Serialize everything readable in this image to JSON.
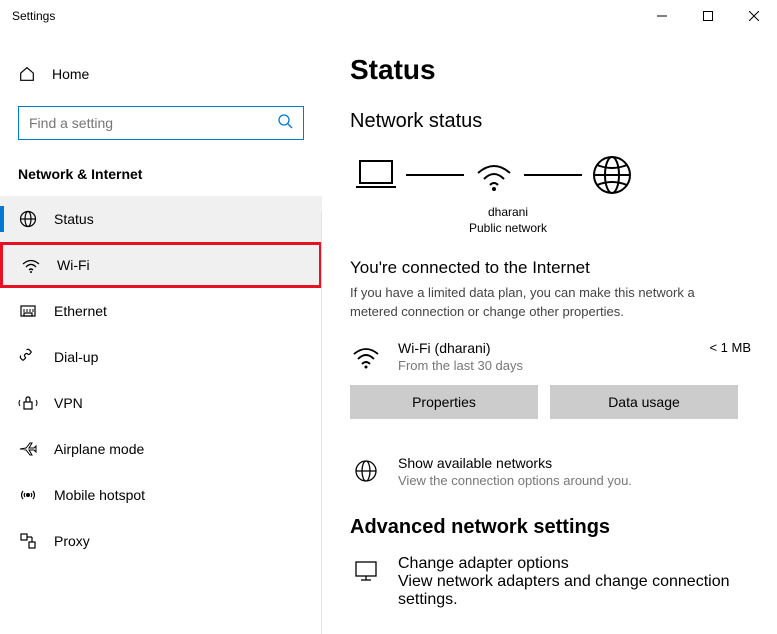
{
  "window": {
    "title": "Settings"
  },
  "sidebar": {
    "home": "Home",
    "search_placeholder": "Find a setting",
    "section": "Network & Internet",
    "items": [
      {
        "label": "Status"
      },
      {
        "label": "Wi-Fi"
      },
      {
        "label": "Ethernet"
      },
      {
        "label": "Dial-up"
      },
      {
        "label": "VPN"
      },
      {
        "label": "Airplane mode"
      },
      {
        "label": "Mobile hotspot"
      },
      {
        "label": "Proxy"
      }
    ]
  },
  "main": {
    "title": "Status",
    "network_status_heading": "Network status",
    "diagram": {
      "ssid": "dharani",
      "network_type": "Public network"
    },
    "connected_title": "You're connected to the Internet",
    "connected_desc": "If you have a limited data plan, you can make this network a metered connection or change other properties.",
    "connection": {
      "name": "Wi-Fi (dharani)",
      "period": "From the last 30 days",
      "usage": "< 1 MB"
    },
    "buttons": {
      "properties": "Properties",
      "data_usage": "Data usage"
    },
    "available_networks": {
      "label": "Show available networks",
      "desc": "View the connection options around you."
    },
    "advanced_heading": "Advanced network settings",
    "adapter_options": {
      "label": "Change adapter options",
      "desc": "View network adapters and change connection settings."
    }
  }
}
